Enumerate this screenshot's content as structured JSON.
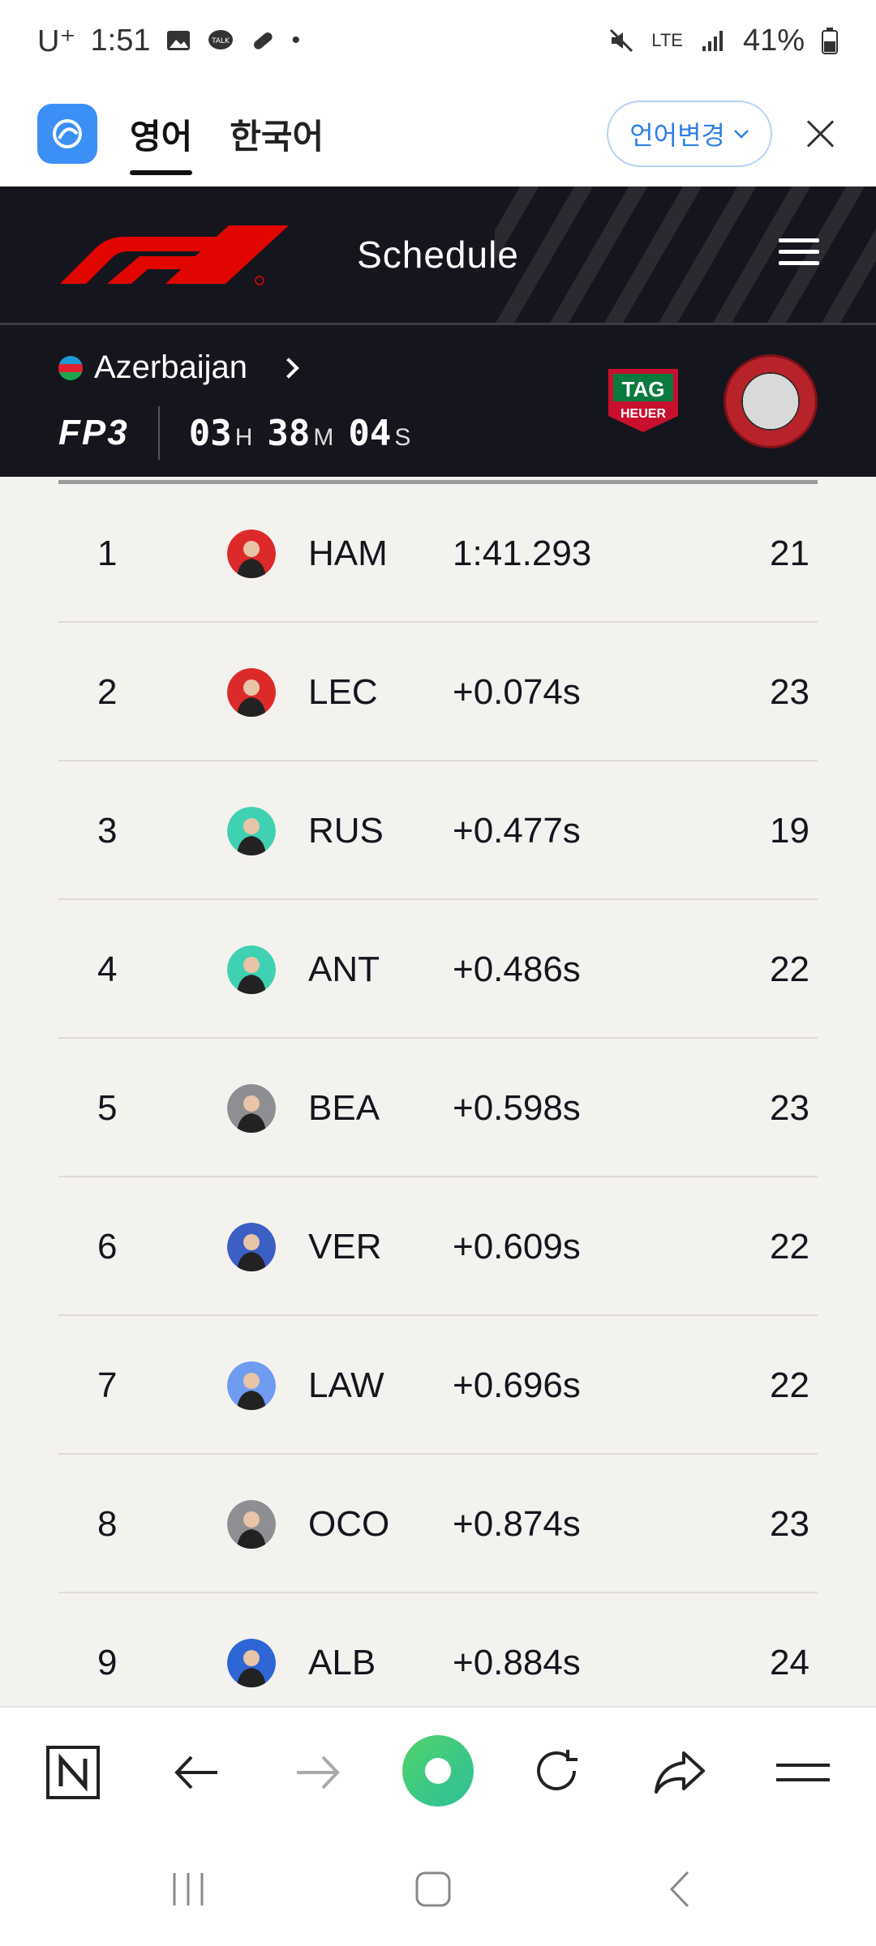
{
  "status_bar": {
    "carrier": "U⁺",
    "time": "1:51",
    "network": "LTE",
    "battery": "41%"
  },
  "translate_bar": {
    "tab_source": "영어",
    "tab_target": "한국어",
    "change_language_label": "언어변경"
  },
  "header": {
    "title": "Schedule",
    "brand_color": "#e10600"
  },
  "session": {
    "country": "Azerbaijan",
    "label": "FP3",
    "countdown": {
      "hours": "03",
      "hours_unit": "H",
      "minutes": "38",
      "minutes_unit": "M",
      "seconds": "04",
      "seconds_unit": "S"
    },
    "sponsor_text_top": "TAG",
    "sponsor_text_bottom": "HEUER"
  },
  "results": [
    {
      "pos": "1",
      "code": "HAM",
      "time": "1:41.293",
      "laps": "21",
      "team_color": "#dc2a2a"
    },
    {
      "pos": "2",
      "code": "LEC",
      "time": "+0.074s",
      "laps": "23",
      "team_color": "#dc2a2a"
    },
    {
      "pos": "3",
      "code": "RUS",
      "time": "+0.477s",
      "laps": "19",
      "team_color": "#3fd1b2"
    },
    {
      "pos": "4",
      "code": "ANT",
      "time": "+0.486s",
      "laps": "22",
      "team_color": "#3fd1b2"
    },
    {
      "pos": "5",
      "code": "BEA",
      "time": "+0.598s",
      "laps": "23",
      "team_color": "#8e8e93"
    },
    {
      "pos": "6",
      "code": "VER",
      "time": "+0.609s",
      "laps": "22",
      "team_color": "#3b5fc4"
    },
    {
      "pos": "7",
      "code": "LAW",
      "time": "+0.696s",
      "laps": "22",
      "team_color": "#6f9cf0"
    },
    {
      "pos": "8",
      "code": "OCO",
      "time": "+0.874s",
      "laps": "23",
      "team_color": "#8e8e93"
    },
    {
      "pos": "9",
      "code": "ALB",
      "time": "+0.884s",
      "laps": "24",
      "team_color": "#2e66d6"
    }
  ],
  "browser_toolbar": {
    "items": [
      "n-logo-icon",
      "back-arrow-icon",
      "forward-arrow-icon",
      "home-green-icon",
      "refresh-icon",
      "share-icon",
      "menu-icon"
    ]
  },
  "nav_bar": {
    "items": [
      "recents-icon",
      "home-icon",
      "back-icon"
    ]
  }
}
